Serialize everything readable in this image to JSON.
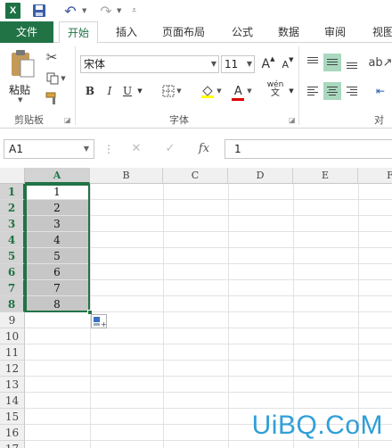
{
  "qat": {
    "logo": "X",
    "save_icon": "save-icon",
    "undo_icon": "undo-icon",
    "redo_icon": "redo-icon"
  },
  "tabs": [
    {
      "label": "文件",
      "active": false
    },
    {
      "label": "开始",
      "active": true
    },
    {
      "label": "插入",
      "active": false
    },
    {
      "label": "页面布局",
      "active": false
    },
    {
      "label": "公式",
      "active": false
    },
    {
      "label": "数据",
      "active": false
    },
    {
      "label": "审阅",
      "active": false
    },
    {
      "label": "视图",
      "active": false
    }
  ],
  "ribbon": {
    "clipboard": {
      "paste_label": "粘贴",
      "group_label": "剪贴板"
    },
    "font": {
      "font_name": "宋体",
      "font_size": "11",
      "grow_label": "A",
      "shrink_label": "A",
      "bold": "B",
      "italic": "I",
      "underline": "U",
      "font_color_label": "A",
      "phonetic_label": "wén",
      "group_label": "字体"
    },
    "alignment": {
      "group_label": "对齐"
    }
  },
  "formula_bar": {
    "name_box": "A1",
    "fx_label": "fx",
    "value": "1"
  },
  "sheet": {
    "columns": [
      "A",
      "B",
      "C",
      "D",
      "E",
      "F"
    ],
    "rows": [
      "1",
      "2",
      "3",
      "4",
      "5",
      "6",
      "7",
      "8",
      "9",
      "10",
      "11",
      "12",
      "13",
      "14",
      "15",
      "16",
      "17"
    ],
    "col_a_values": [
      "1",
      "2",
      "3",
      "4",
      "5",
      "6",
      "7",
      "8"
    ],
    "selected_column": "A",
    "selected_rows": [
      "1",
      "2",
      "3",
      "4",
      "5",
      "6",
      "7",
      "8"
    ]
  },
  "watermark": "UiBQ.CoM",
  "colors": {
    "accent": "#217346",
    "selection_fill": "#c6c6c6",
    "watermark": "#2f9fd8"
  }
}
